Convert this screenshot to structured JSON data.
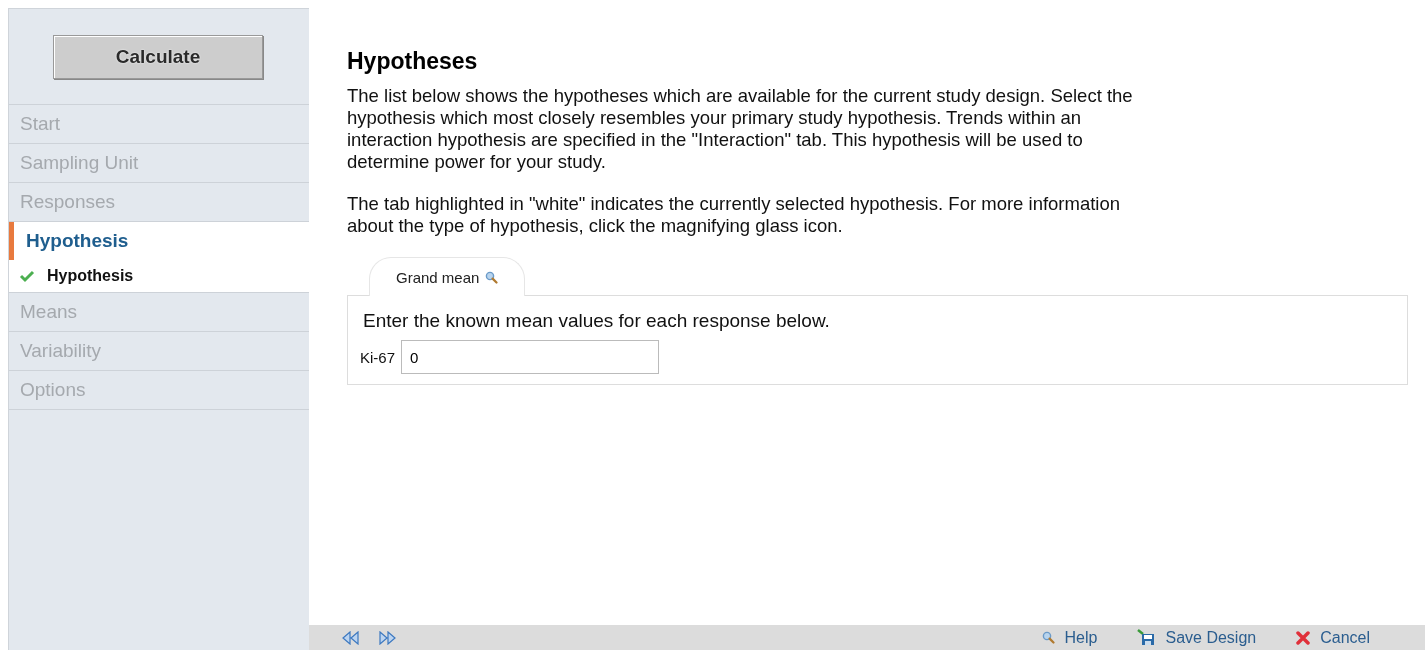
{
  "sidebar": {
    "calculate_button": "Calculate",
    "items": [
      {
        "label": "Start",
        "selected": false
      },
      {
        "label": "Sampling Unit",
        "selected": false
      },
      {
        "label": "Responses",
        "selected": false
      },
      {
        "label": "Hypothesis",
        "selected": true,
        "children": [
          {
            "label": "Hypothesis",
            "checked": true
          }
        ]
      },
      {
        "label": "Means",
        "selected": false
      },
      {
        "label": "Variability",
        "selected": false
      },
      {
        "label": "Options",
        "selected": false
      }
    ]
  },
  "main": {
    "title": "Hypotheses",
    "paragraphs": [
      "The list below shows the hypotheses which are available for the current study design. Select the hypothesis which most closely resembles your primary study hypothesis. Trends within an interaction hypothesis are specified in the \"Interaction\" tab. This hypothesis will be used to determine power for your study.",
      "The tab highlighted in \"white\" indicates the currently selected hypothesis. For more information about the type of hypothesis, click the magnifying glass icon."
    ],
    "tabs": [
      {
        "label": "Grand mean",
        "selected": true
      }
    ],
    "panel": {
      "instruction": "Enter the known mean values for each response below.",
      "fields": [
        {
          "label": "Ki-67",
          "value": "0"
        }
      ]
    }
  },
  "footer": {
    "actions": [
      {
        "kind": "help",
        "label": "Help"
      },
      {
        "kind": "save",
        "label": "Save Design"
      },
      {
        "kind": "cancel",
        "label": "Cancel"
      }
    ]
  }
}
